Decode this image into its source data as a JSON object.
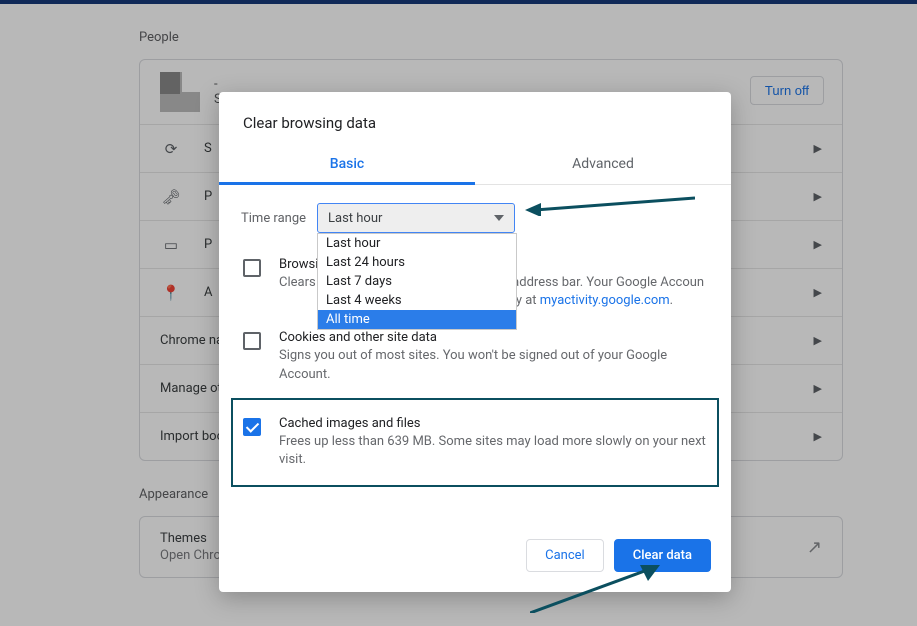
{
  "sections": {
    "people": "People",
    "appearance": "Appearance"
  },
  "profile": {
    "line1": "-",
    "line2": "S"
  },
  "turn_off": "Turn off",
  "rows": {
    "sync": {
      "label": "S"
    },
    "pass": {
      "label": "P"
    },
    "payment": {
      "label": "P"
    },
    "address": {
      "label": "A"
    },
    "chrome": {
      "label": "Chrome na"
    },
    "manage": {
      "label": "Manage ot"
    },
    "import": {
      "label": "Import boo"
    }
  },
  "themes": {
    "title": "Themes",
    "sub": "Open Chrome Web Store"
  },
  "dialog": {
    "title": "Clear browsing data",
    "tabs": {
      "basic": "Basic",
      "advanced": "Advanced"
    },
    "time_range_label": "Time range",
    "select_value": "Last hour",
    "options": {
      "o1": "Last hour",
      "o2": "Last 24 hours",
      "o3": "Last 7 days",
      "o4": "Last 4 weeks",
      "o5": "All time"
    },
    "browsing": {
      "title": "Browsi",
      "sub_a": "Clears ",
      "sub_b": " address bar. Your Google Accoun",
      "sub_c": "g history at ",
      "link": "myactivity.google.com"
    },
    "cookies": {
      "title": "Cookies and other site data",
      "sub": "Signs you out of most sites. You won't be signed out of your Google Account."
    },
    "cached": {
      "title": "Cached images and files",
      "sub": "Frees up less than 639 MB. Some sites may load more slowly on your next visit."
    },
    "cancel": "Cancel",
    "clear": "Clear data"
  }
}
